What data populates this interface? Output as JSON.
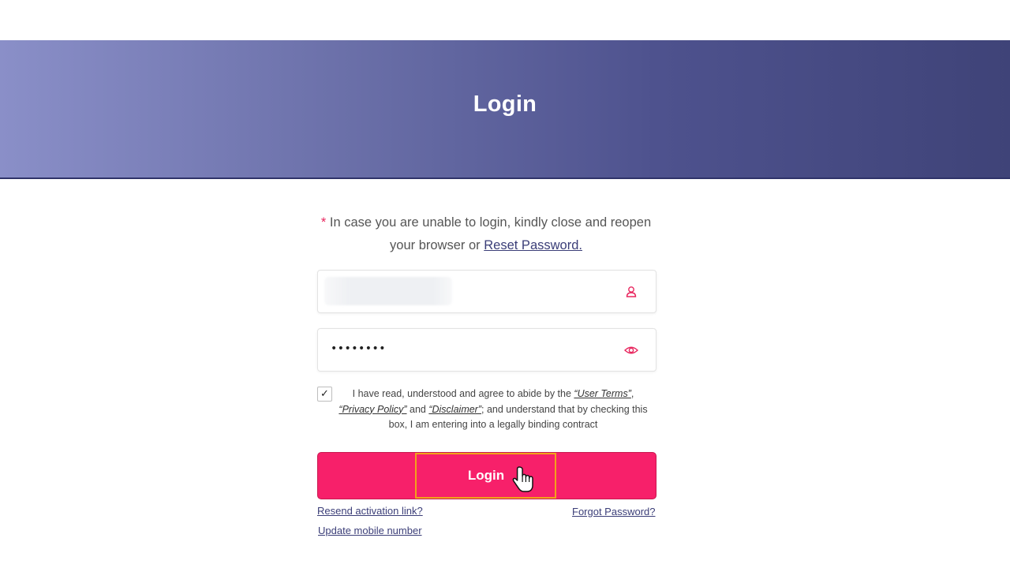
{
  "header": {
    "title": "Login"
  },
  "notice": {
    "asterisk": "*",
    "text": " In case you are unable to login, kindly close and reopen your browser or ",
    "link": "Reset Password."
  },
  "form": {
    "username": {
      "icon": "user-icon"
    },
    "password": {
      "value": "••••••••",
      "icon": "eye-icon"
    }
  },
  "terms": {
    "checked": true,
    "check_glyph": "✓",
    "prefix": "I have read, understood and agree to abide by the ",
    "user_terms": "“User Terms”",
    "comma": ", ",
    "privacy": "“Privacy Policy”",
    "and": " and ",
    "disclaimer": "“Disclaimer”",
    "suffix": "; and understand that by checking this box, I am entering into a legally binding contract"
  },
  "login_button": {
    "label": "Login"
  },
  "links": {
    "resend": "Resend activation link?",
    "forgot": "Forgot Password?",
    "update": "Update mobile number"
  },
  "colors": {
    "accent": "#f7206a",
    "banner_dark": "#3f4378",
    "banner_light": "#8a8fc8",
    "focus_outline": "#f2a21a"
  }
}
